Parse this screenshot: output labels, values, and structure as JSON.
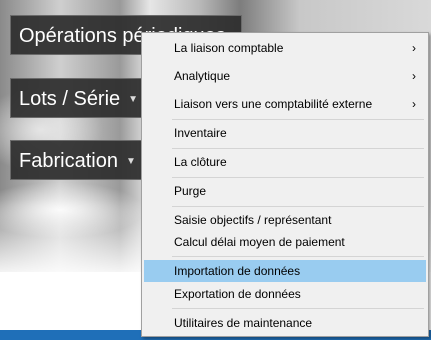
{
  "side_menu": {
    "operations": "Opérations périodiques",
    "lots": "Lots / Série",
    "fabrication": "Fabrication",
    "caret_icon": "chevron-down-icon"
  },
  "context_menu": {
    "items": [
      {
        "label": "La liaison comptable",
        "submenu": true,
        "arrow": "›"
      },
      {
        "label": "Analytique",
        "submenu": true,
        "arrow": "›"
      },
      {
        "label": "Liaison vers une comptabilité externe",
        "submenu": true,
        "arrow": "›"
      },
      {
        "label": "Inventaire",
        "submenu": false
      },
      {
        "label": "La clôture",
        "submenu": false
      },
      {
        "label": "Purge",
        "submenu": false
      },
      {
        "label": "Saisie objectifs / représentant",
        "submenu": false
      },
      {
        "label": "Calcul délai moyen de paiement",
        "submenu": false
      },
      {
        "label": "Importation de données",
        "submenu": false,
        "highlighted": true
      },
      {
        "label": "Exportation de données",
        "submenu": false
      },
      {
        "label": "Utilitaires de maintenance",
        "submenu": false
      }
    ]
  },
  "colors": {
    "highlight": "#99ccf0",
    "menu_bg": "#f0f0f0",
    "side_btn_bg": "#2d2d2d",
    "bottom_strip": "#1f6fb8"
  }
}
